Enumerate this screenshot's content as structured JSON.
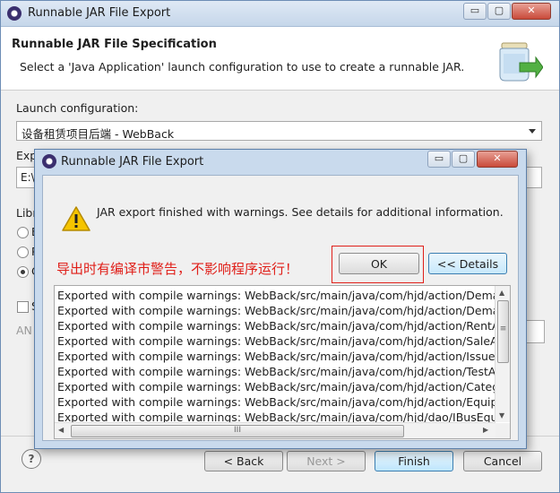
{
  "window": {
    "title": "Runnable JAR File Export",
    "controls": {
      "minimize": "▭",
      "maximize": "▢",
      "close": "✕"
    }
  },
  "header": {
    "title": "Runnable JAR File Specification",
    "description": "Select a 'Java Application' launch configuration to use to create a runnable JAR."
  },
  "form": {
    "launch_label": "Launch configuration:",
    "launch_value": "设备租赁项目后端 - WebBack",
    "export_label_partial": "Exp",
    "export_value_partial": "E:\\",
    "library_label_partial": "Libr",
    "radio_partials": [
      "E",
      "P",
      "C"
    ],
    "save_label_partial": "S",
    "ant_label_partial": "AN"
  },
  "footer": {
    "help": "?",
    "back": "< Back",
    "next": "Next >",
    "finish": "Finish",
    "cancel": "Cancel"
  },
  "dialog": {
    "title": "Runnable JAR File Export",
    "message": "JAR export finished with warnings. See details for additional information.",
    "annotation": "导出时有编译市警告，不影响程序运行！",
    "ok_label": "OK",
    "details_label": "<< Details",
    "hscroll_grip": "III",
    "vscroll_grip": "≡",
    "log_lines": [
      "Exported with compile warnings: WebBack/src/main/java/com/hjd/action/DemandSa",
      "Exported with compile warnings: WebBack/src/main/java/com/hjd/action/DemandR",
      "Exported with compile warnings: WebBack/src/main/java/com/hjd/action/RentAction",
      "Exported with compile warnings: WebBack/src/main/java/com/hjd/action/SaleAction",
      "Exported with compile warnings: WebBack/src/main/java/com/hjd/action/IssueActio",
      "Exported with compile warnings: WebBack/src/main/java/com/hjd/action/TestAction",
      "Exported with compile warnings: WebBack/src/main/java/com/hjd/action/CategoryA",
      "Exported with compile warnings: WebBack/src/main/java/com/hjd/action/Equipmen",
      "Exported with compile warnings: WebBack/src/main/java/com/hjd/dao/IBusEquNam"
    ]
  },
  "colors": {
    "annotation_red": "#e0201a",
    "titlebar_blue": "#c9daed",
    "default_button_blue": "#3c7fb1"
  }
}
